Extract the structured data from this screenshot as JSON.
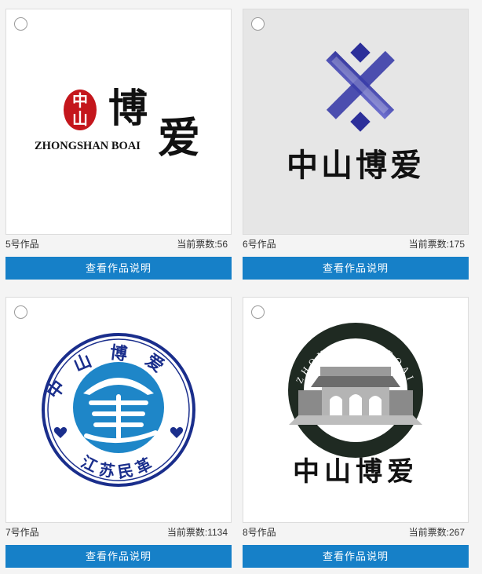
{
  "works": [
    {
      "title": "5号作品",
      "votes_label": "当前票数:",
      "votes": "56",
      "button_label": "查看作品说明",
      "logo": {
        "seal_top": "中",
        "seal_bottom": "山",
        "chars_a": "博",
        "chars_b": "爱",
        "latin": "ZHONGSHAN BOAI"
      }
    },
    {
      "title": "6号作品",
      "votes_label": "当前票数:",
      "votes": "175",
      "button_label": "查看作品说明",
      "logo": {
        "chinese": "中山博爱"
      }
    },
    {
      "title": "7号作品",
      "votes_label": "当前票数:",
      "votes": "1134",
      "button_label": "查看作品说明",
      "logo": {
        "ring_top": "中山博爱",
        "ring_bottom": "江苏民革"
      }
    },
    {
      "title": "8号作品",
      "votes_label": "当前票数:",
      "votes": "267",
      "button_label": "查看作品说明",
      "logo": {
        "ring_text": "ZHONGSHAN BOAI",
        "chinese": "中山博爱"
      }
    }
  ],
  "colors": {
    "button_bg": "#1680c8",
    "button_text": "#ffffff",
    "logo6_blue": "#2c2f9a",
    "logo7_blue": "#1a2e8c",
    "logo7_fill": "#1e86c8",
    "logo8_ring": "#1f2a22",
    "seal_red": "#c4161c"
  }
}
